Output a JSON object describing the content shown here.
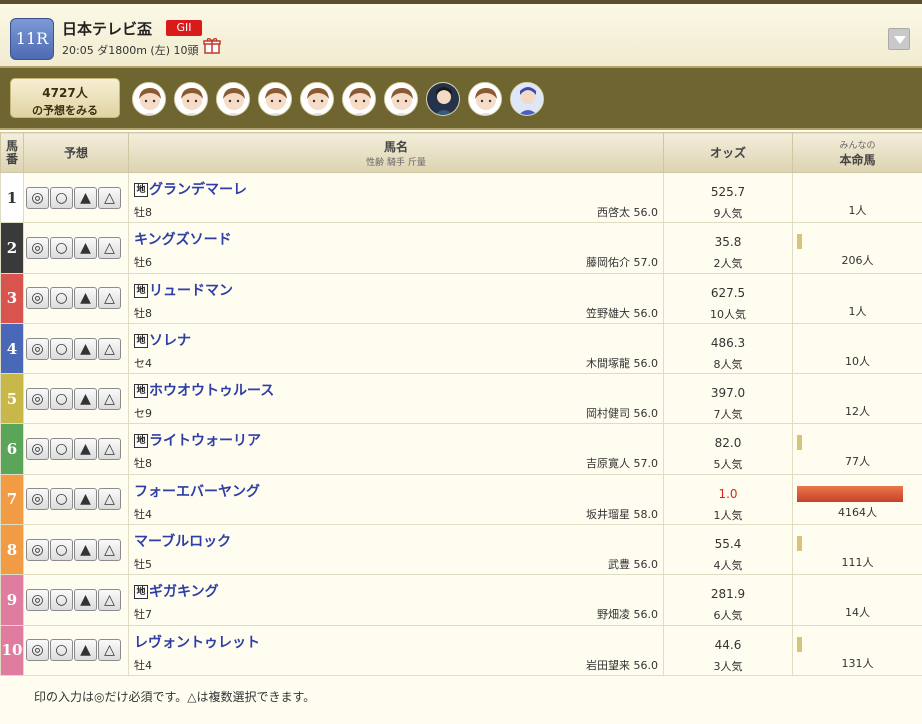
{
  "race": {
    "number": "11R",
    "name": "日本テレビ盃",
    "grade": "GII",
    "info": "20:05 ダ1800m (左) 10頭"
  },
  "predictor": {
    "count_label": "4727人",
    "action_label": "の予想をみる",
    "avatar_count": 10
  },
  "table": {
    "headers": {
      "umaban": "馬番",
      "yoso": "予想",
      "horse": "馬名",
      "horse_sub": "性齢 騎手 斤量",
      "odds": "オッズ",
      "honmei_sub": "みんなの",
      "honmei": "本命馬"
    },
    "marks": [
      "◎",
      "○",
      "▲",
      "△"
    ],
    "local_label": "地",
    "rows": [
      {
        "num": "1",
        "color": "#ffffff",
        "text_color": "#333333",
        "local": true,
        "name": "グランデマーレ",
        "sexage": "牡8",
        "jockey": "西啓太 56.0",
        "odds": "525.7",
        "pop": "9人気",
        "votes": "1人",
        "vote_share": 0,
        "odds_red": false
      },
      {
        "num": "2",
        "color": "#3a3a3a",
        "text_color": "#ffffff",
        "local": false,
        "name": "キングズソード",
        "sexage": "牡6",
        "jockey": "藤岡佑介 57.0",
        "odds": "35.8",
        "pop": "2人気",
        "votes": "206人",
        "vote_share": 0.049,
        "odds_red": false
      },
      {
        "num": "3",
        "color": "#d9534f",
        "text_color": "#ffffff",
        "local": true,
        "name": "リュードマン",
        "sexage": "牡8",
        "jockey": "笠野雄大 56.0",
        "odds": "627.5",
        "pop": "10人気",
        "votes": "1人",
        "vote_share": 0,
        "odds_red": false
      },
      {
        "num": "4",
        "color": "#4a68b8",
        "text_color": "#ffffff",
        "local": true,
        "name": "ソレナ",
        "sexage": "セ4",
        "jockey": "木間塚龍 56.0",
        "odds": "486.3",
        "pop": "8人気",
        "votes": "10人",
        "vote_share": 0,
        "odds_red": false
      },
      {
        "num": "5",
        "color": "#c8b84a",
        "text_color": "#ffffff",
        "local": true,
        "name": "ホウオウトゥルース",
        "sexage": "セ9",
        "jockey": "岡村健司 56.0",
        "odds": "397.0",
        "pop": "7人気",
        "votes": "12人",
        "vote_share": 0,
        "odds_red": false
      },
      {
        "num": "6",
        "color": "#5aa55a",
        "text_color": "#ffffff",
        "local": true,
        "name": "ライトウォーリア",
        "sexage": "牡8",
        "jockey": "吉原寛人 57.0",
        "odds": "82.0",
        "pop": "5人気",
        "votes": "77人",
        "vote_share": 0.018,
        "odds_red": false
      },
      {
        "num": "7",
        "color": "#f29b45",
        "text_color": "#ffffff",
        "local": false,
        "name": "フォーエバーヤング",
        "sexage": "牡4",
        "jockey": "坂井瑠星 58.0",
        "odds": "1.0",
        "pop": "1人気",
        "votes": "4164人",
        "vote_share": 0.98,
        "odds_red": true
      },
      {
        "num": "8",
        "color": "#f29b45",
        "text_color": "#ffffff",
        "local": false,
        "name": "マーブルロック",
        "sexage": "牡5",
        "jockey": "武豊 56.0",
        "odds": "55.4",
        "pop": "4人気",
        "votes": "111人",
        "vote_share": 0.026,
        "odds_red": false
      },
      {
        "num": "9",
        "color": "#e07ca0",
        "text_color": "#ffffff",
        "local": true,
        "name": "ギガキング",
        "sexage": "牡7",
        "jockey": "野畑凌 56.0",
        "odds": "281.9",
        "pop": "6人気",
        "votes": "14人",
        "vote_share": 0,
        "odds_red": false
      },
      {
        "num": "10",
        "color": "#e07ca0",
        "text_color": "#ffffff",
        "local": false,
        "name": "レヴォントゥレット",
        "sexage": "牡4",
        "jockey": "岩田望来 56.0",
        "odds": "44.6",
        "pop": "3人気",
        "votes": "131人",
        "vote_share": 0.031,
        "odds_red": false
      }
    ]
  },
  "footer": {
    "note": "印の入力は◎だけ必須です。△は複数選択できます。"
  }
}
